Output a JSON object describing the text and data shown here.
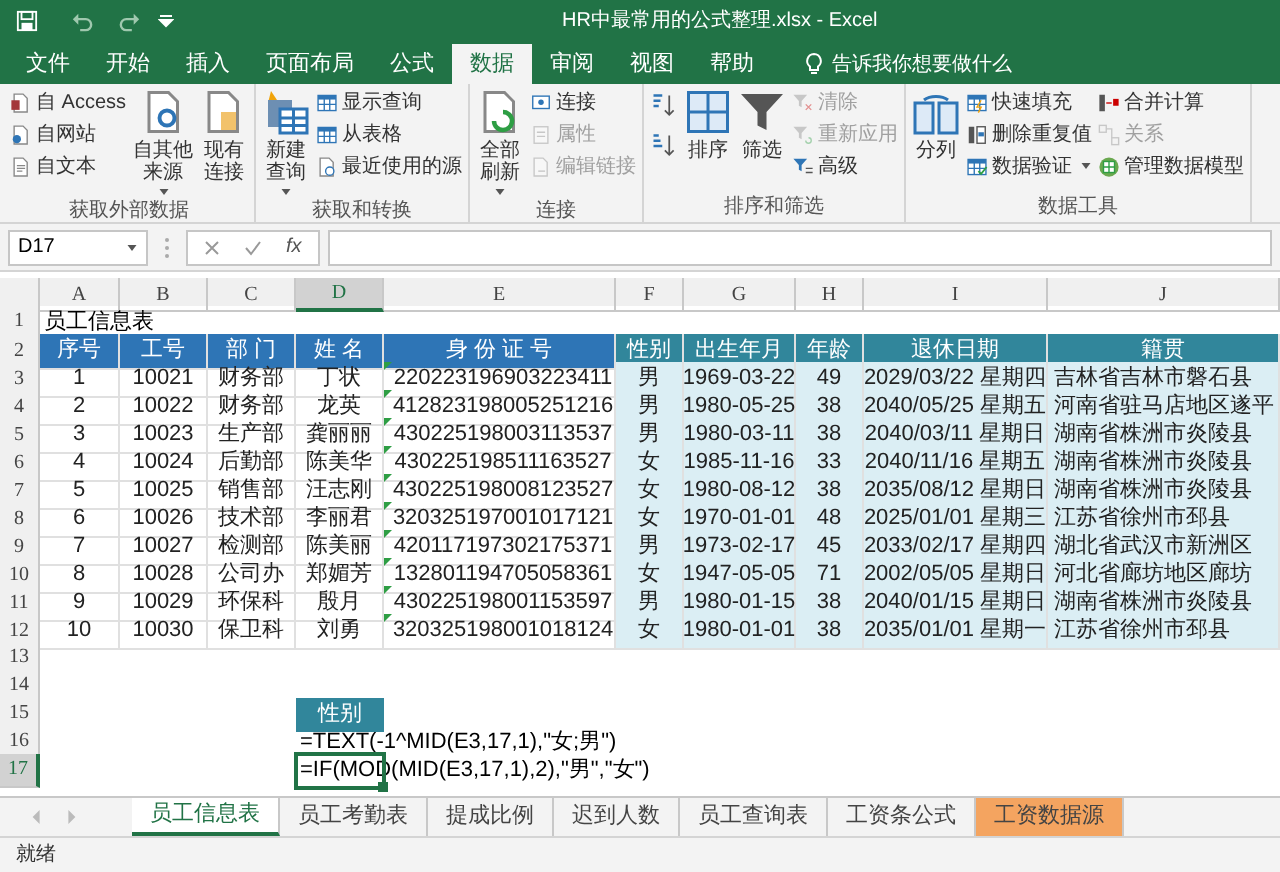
{
  "window": {
    "title": "HR中最常用的公式整理.xlsx  -  Excel"
  },
  "menu_tabs": [
    {
      "label": "文件",
      "selected": false
    },
    {
      "label": "开始",
      "selected": false
    },
    {
      "label": "插入",
      "selected": false
    },
    {
      "label": "页面布局",
      "selected": false
    },
    {
      "label": "公式",
      "selected": false
    },
    {
      "label": "数据",
      "selected": true
    },
    {
      "label": "审阅",
      "selected": false
    },
    {
      "label": "视图",
      "selected": false
    },
    {
      "label": "帮助",
      "selected": false
    }
  ],
  "tell_me": {
    "placeholder": "告诉我你想要做什么"
  },
  "ribbon_groups": [
    {
      "label": "获取外部数据",
      "items": [
        {
          "kind": "small",
          "label": "自 Access",
          "disabled": false
        },
        {
          "kind": "small",
          "label": "自网站",
          "disabled": false
        },
        {
          "kind": "small",
          "label": "自文本",
          "disabled": false
        },
        {
          "kind": "large",
          "label": "自其他来源",
          "disabled": false,
          "dropdown": true
        },
        {
          "kind": "large",
          "label": "现有连接",
          "disabled": false
        }
      ]
    },
    {
      "label": "获取和转换",
      "items": [
        {
          "kind": "large",
          "label": "新建查询",
          "disabled": false,
          "dropdown": true
        },
        {
          "kind": "small",
          "label": "显示查询",
          "disabled": false
        },
        {
          "kind": "small",
          "label": "从表格",
          "disabled": false
        },
        {
          "kind": "small",
          "label": "最近使用的源",
          "disabled": false
        }
      ]
    },
    {
      "label": "连接",
      "items": [
        {
          "kind": "large",
          "label": "全部刷新",
          "disabled": false,
          "dropdown": true
        },
        {
          "kind": "small",
          "label": "连接",
          "disabled": false
        },
        {
          "kind": "small",
          "label": "属性",
          "disabled": true
        },
        {
          "kind": "small",
          "label": "编辑链接",
          "disabled": true
        }
      ]
    },
    {
      "label": "排序和筛选",
      "items": [
        {
          "kind": "icon",
          "disabled": false
        },
        {
          "kind": "icon",
          "disabled": false
        },
        {
          "kind": "large",
          "label": "排序",
          "disabled": false
        },
        {
          "kind": "large",
          "label": "筛选",
          "disabled": false
        },
        {
          "kind": "small",
          "label": "清除",
          "disabled": true
        },
        {
          "kind": "small",
          "label": "重新应用",
          "disabled": true
        },
        {
          "kind": "small",
          "label": "高级",
          "disabled": false
        }
      ]
    },
    {
      "label": "数据工具",
      "items": [
        {
          "kind": "large",
          "label": "分列",
          "disabled": false
        },
        {
          "kind": "small",
          "label": "快速填充",
          "disabled": false
        },
        {
          "kind": "small",
          "label": "删除重复值",
          "disabled": false
        },
        {
          "kind": "small",
          "label": "数据验证",
          "disabled": false,
          "dropdown": true
        },
        {
          "kind": "small",
          "label": "合并计算",
          "disabled": false
        },
        {
          "kind": "small",
          "label": "关系",
          "disabled": true
        },
        {
          "kind": "small",
          "label": "管理数据模型",
          "disabled": false
        }
      ]
    }
  ],
  "formula_bar": {
    "name_box": "D17",
    "function_label": "fx"
  },
  "sheet": {
    "columns": [
      {
        "letter": "A",
        "selected": false
      },
      {
        "letter": "B",
        "selected": false
      },
      {
        "letter": "C",
        "selected": false
      },
      {
        "letter": "D",
        "selected": true
      },
      {
        "letter": "E",
        "selected": false
      },
      {
        "letter": "F",
        "selected": false
      },
      {
        "letter": "G",
        "selected": false
      },
      {
        "letter": "H",
        "selected": false
      },
      {
        "letter": "I",
        "selected": false
      },
      {
        "letter": "J",
        "selected": false
      }
    ],
    "rows": [
      {
        "number": "1",
        "selected": false,
        "kind": "title",
        "title": "员工信息表"
      },
      {
        "number": "2",
        "selected": false,
        "kind": "header",
        "cells": [
          "序号",
          "工号",
          "部 门",
          "姓 名",
          "身 份 证 号",
          "性别",
          "出生年月",
          "年龄",
          "退休日期",
          "籍贯"
        ]
      },
      {
        "number": "3",
        "selected": false,
        "kind": "data",
        "cells": [
          "1",
          "10021",
          "财务部",
          "丁状",
          "220223196903223411",
          "男",
          "1969-03-22",
          "49",
          "2029/03/22 星期四",
          "吉林省吉林市磐石县"
        ]
      },
      {
        "number": "4",
        "selected": false,
        "kind": "data",
        "cells": [
          "2",
          "10022",
          "财务部",
          "龙英",
          "412823198005251216",
          "男",
          "1980-05-25",
          "38",
          "2040/05/25 星期五",
          "河南省驻马店地区遂平"
        ]
      },
      {
        "number": "5",
        "selected": false,
        "kind": "data",
        "cells": [
          "3",
          "10023",
          "生产部",
          "龚丽丽",
          "430225198003113537",
          "男",
          "1980-03-11",
          "38",
          "2040/03/11 星期日",
          "湖南省株洲市炎陵县"
        ]
      },
      {
        "number": "6",
        "selected": false,
        "kind": "data",
        "cells": [
          "4",
          "10024",
          "后勤部",
          "陈美华",
          "430225198511163527",
          "女",
          "1985-11-16",
          "33",
          "2040/11/16 星期五",
          "湖南省株洲市炎陵县"
        ]
      },
      {
        "number": "7",
        "selected": false,
        "kind": "data",
        "cells": [
          "5",
          "10025",
          "销售部",
          "汪志刚",
          "430225198008123527",
          "女",
          "1980-08-12",
          "38",
          "2035/08/12 星期日",
          "湖南省株洲市炎陵县"
        ]
      },
      {
        "number": "8",
        "selected": false,
        "kind": "data",
        "cells": [
          "6",
          "10026",
          "技术部",
          "李丽君",
          "320325197001017121",
          "女",
          "1970-01-01",
          "48",
          "2025/01/01 星期三",
          "江苏省徐州市邳县"
        ]
      },
      {
        "number": "9",
        "selected": false,
        "kind": "data",
        "cells": [
          "7",
          "10027",
          "检测部",
          "陈美丽",
          "420117197302175371",
          "男",
          "1973-02-17",
          "45",
          "2033/02/17 星期四",
          "湖北省武汉市新洲区"
        ]
      },
      {
        "number": "10",
        "selected": false,
        "kind": "data",
        "cells": [
          "8",
          "10028",
          "公司办",
          "郑媚芳",
          "132801194705058361",
          "女",
          "1947-05-05",
          "71",
          "2002/05/05 星期日",
          "河北省廊坊地区廊坊"
        ]
      },
      {
        "number": "11",
        "selected": false,
        "kind": "data",
        "cells": [
          "9",
          "10029",
          "环保科",
          "殷月",
          "430225198001153597",
          "男",
          "1980-01-15",
          "38",
          "2040/01/15 星期日",
          "湖南省株洲市炎陵县"
        ]
      },
      {
        "number": "12",
        "selected": false,
        "kind": "data",
        "cells": [
          "10",
          "10030",
          "保卫科",
          "刘勇",
          "320325198001018124",
          "女",
          "1980-01-01",
          "38",
          "2035/01/01 星期一",
          "江苏省徐州市邳县"
        ]
      },
      {
        "number": "13",
        "selected": false,
        "kind": "empty"
      },
      {
        "number": "14",
        "selected": false,
        "kind": "empty"
      },
      {
        "number": "15",
        "selected": false,
        "kind": "label",
        "text": "性别"
      },
      {
        "number": "16",
        "selected": false,
        "kind": "formula",
        "text": "=TEXT(-1^MID(E3,17,1),\"女;男\")"
      },
      {
        "number": "17",
        "selected": true,
        "kind": "formula",
        "text": "=IF(MOD(MID(E3,17,1),2),\"男\",\"女\")"
      }
    ]
  },
  "sheet_tabs": [
    {
      "label": "员工信息表",
      "selected": true
    },
    {
      "label": "员工考勤表",
      "selected": false
    },
    {
      "label": "提成比例",
      "selected": false
    },
    {
      "label": "迟到人数",
      "selected": false
    },
    {
      "label": "员工查询表",
      "selected": false
    },
    {
      "label": "工资条公式",
      "selected": false
    },
    {
      "label": "工资数据源",
      "selected": false,
      "color": "#f4a460"
    }
  ],
  "status_bar": {
    "text": "就绪"
  }
}
